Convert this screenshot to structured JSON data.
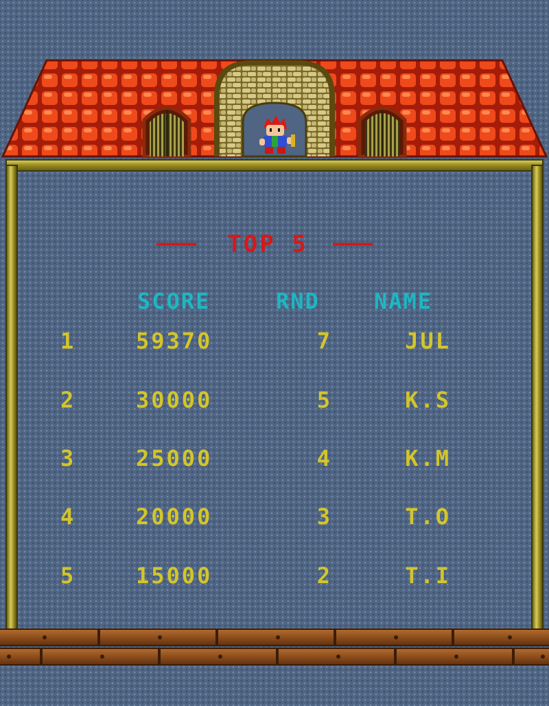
{
  "title": "TOP 5",
  "headers": {
    "score": "SCORE",
    "round": "RND",
    "name": "NAME"
  },
  "entries": [
    {
      "rank": "1",
      "score": "59370",
      "round": "7",
      "name": "JUL"
    },
    {
      "rank": "2",
      "score": "30000",
      "round": "5",
      "name": "K.S"
    },
    {
      "rank": "3",
      "score": "25000",
      "round": "4",
      "name": "K.M"
    },
    {
      "rank": "4",
      "score": "20000",
      "round": "3",
      "name": "T.O"
    },
    {
      "rank": "5",
      "score": "15000",
      "round": "2",
      "name": "T.I"
    }
  ],
  "colors": {
    "background": "#4f6583",
    "title": "#d81818",
    "header": "#1fb6c2",
    "entry_text": "#d4c52a",
    "roof": "#e0421c",
    "frame": "#c9bc48",
    "floor": "#8a4b1c"
  },
  "icons": [
    "roof",
    "arched-window-left",
    "arched-window-right",
    "stone-archway",
    "player-character-sprite",
    "wooden-floor"
  ]
}
